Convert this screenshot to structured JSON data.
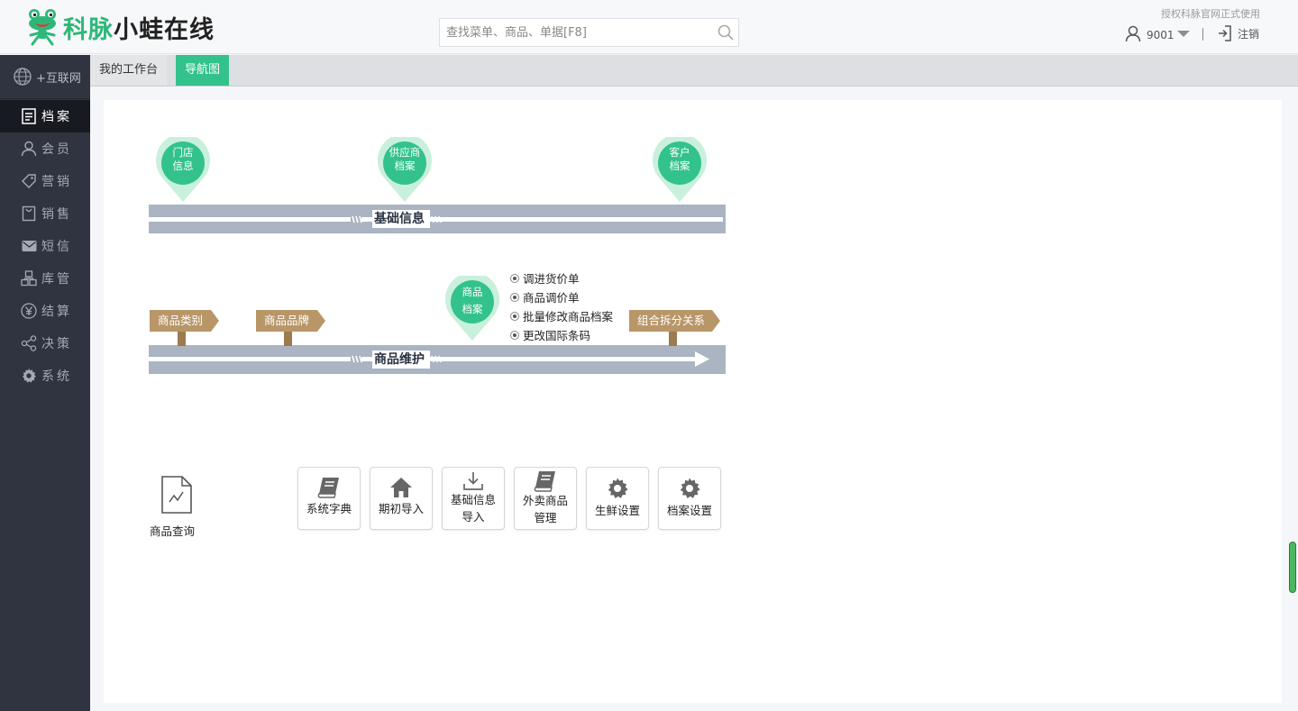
{
  "header": {
    "logo_brand": "科脉",
    "logo_rest": "小蛙在线",
    "search_placeholder": "查找菜单、商品、单据[F8]",
    "auth_text": "授权科脉官网正式使用",
    "username": "9001",
    "logout": "注销"
  },
  "sidebar": {
    "internet": "+互联网",
    "items": [
      {
        "label": "档案",
        "icon": "file-icon",
        "active": true
      },
      {
        "label": "会员",
        "icon": "user-icon"
      },
      {
        "label": "营销",
        "icon": "tag-icon"
      },
      {
        "label": "销售",
        "icon": "bag-icon"
      },
      {
        "label": "短信",
        "icon": "mail-icon"
      },
      {
        "label": "库管",
        "icon": "boxes-icon"
      },
      {
        "label": "结算",
        "icon": "yen-icon"
      },
      {
        "label": "决策",
        "icon": "share-icon"
      },
      {
        "label": "系统",
        "icon": "gear-icon"
      }
    ]
  },
  "tabs": [
    "我的工作台",
    "导航图"
  ],
  "nav": {
    "pins_top": [
      "门店\n信息",
      "供应商\n档案",
      "客户\n档案"
    ],
    "road1": "基础信息",
    "road2": "商品维护",
    "pin_mid": "商品\n档案",
    "signs": [
      "商品类别",
      "商品品牌",
      "组合拆分关系"
    ],
    "options": [
      "调进货价单",
      "商品调价单",
      "批量修改商品档案",
      "更改国际条码"
    ],
    "query": "商品查询",
    "tiles": [
      {
        "label": "系统字典",
        "icon": "book-icon"
      },
      {
        "label": "期初导入",
        "icon": "home-icon"
      },
      {
        "label": "基础信息\n导入",
        "icon": "download-icon"
      },
      {
        "label": "外卖商品\n管理",
        "icon": "book-icon"
      },
      {
        "label": "生鲜设置",
        "icon": "gear-icon"
      },
      {
        "label": "档案设置",
        "icon": "gear-icon"
      }
    ]
  },
  "colors": {
    "accent": "#33c28c",
    "sidebar": "#2f3440",
    "road": "#aab4c2",
    "sign": "#b89668"
  }
}
